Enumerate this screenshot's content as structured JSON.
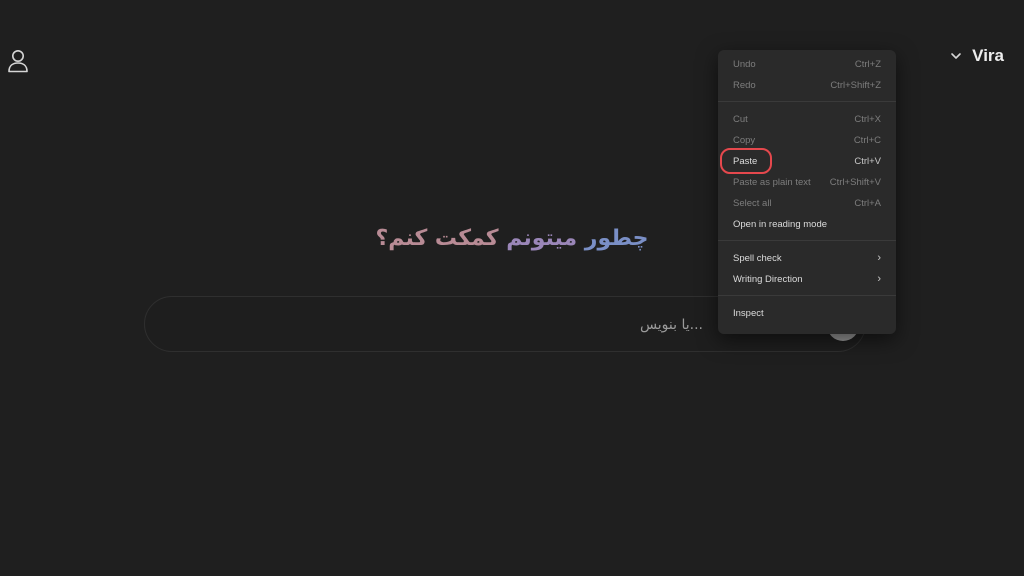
{
  "header": {
    "brand_name": "Vira",
    "user_icon": "user-icon",
    "brand_chevron_icon": "chevron-down-icon"
  },
  "main": {
    "headline": {
      "word1": "چطور",
      "word2": "میتونم",
      "word3": "کمکت کنم؟"
    },
    "composer": {
      "placeholder": "...یا بنویس",
      "send_icon": "send-icon"
    }
  },
  "context_menu": {
    "undo": {
      "label": "Undo",
      "shortcut": "Ctrl+Z"
    },
    "redo": {
      "label": "Redo",
      "shortcut": "Ctrl+Shift+Z"
    },
    "cut": {
      "label": "Cut",
      "shortcut": "Ctrl+X"
    },
    "copy": {
      "label": "Copy",
      "shortcut": "Ctrl+C"
    },
    "paste": {
      "label": "Paste",
      "shortcut": "Ctrl+V"
    },
    "paste_plain": {
      "label": "Paste as plain text",
      "shortcut": "Ctrl+Shift+V"
    },
    "select_all": {
      "label": "Select all",
      "shortcut": "Ctrl+A"
    },
    "reading_mode": {
      "label": "Open in reading mode"
    },
    "spell_check": {
      "label": "Spell check"
    },
    "writing_direction": {
      "label": "Writing Direction"
    },
    "inspect": {
      "label": "Inspect"
    }
  },
  "colors": {
    "background": "#1f1f1f",
    "menu_background": "#2a2a2a",
    "highlight": "#e5484d",
    "headline_blue": "#7a8fc6",
    "headline_purple": "#9a86b8",
    "headline_rose": "#b88b95"
  }
}
